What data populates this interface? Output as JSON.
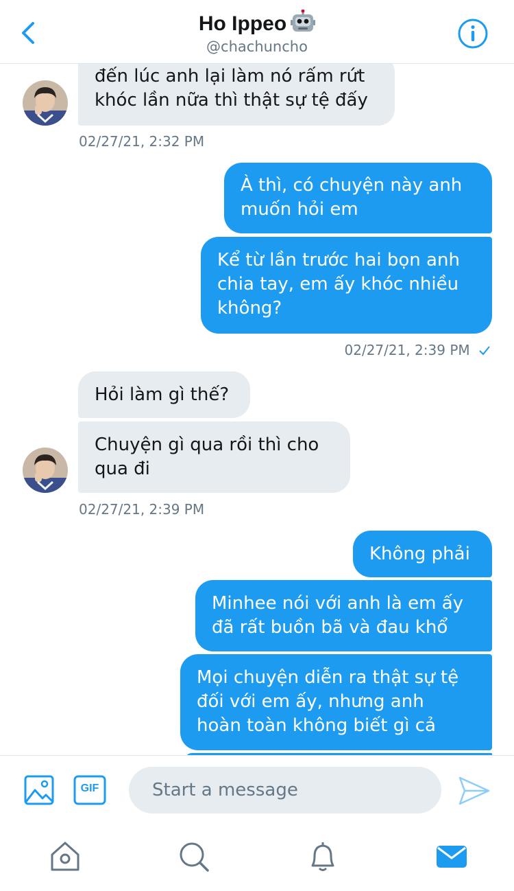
{
  "header": {
    "title": "Ho Ippeo",
    "title_emoji_icon": "robot-icon",
    "handle": "@chachuncho",
    "back_icon": "chevron-left-icon",
    "info_icon": "info-circle-icon"
  },
  "messages": [
    {
      "side": "in",
      "text": "đến lúc anh lại làm nó rấm rứt\nkhóc lần nữa thì thật sự tệ đấy"
    },
    {
      "side": "in",
      "timestamp": "02/27/21, 2:32 PM"
    },
    {
      "side": "out",
      "text": "À thì, có chuyện này anh\nmuốn hỏi em"
    },
    {
      "side": "out",
      "text": "Kể từ lần trước hai bọn anh\nchia tay, em ấy khóc nhiều\nkhông?"
    },
    {
      "side": "out",
      "timestamp": "02/27/21, 2:39 PM",
      "status_icon": "checkmark-icon"
    },
    {
      "side": "in",
      "text": "Hỏi làm gì thế?"
    },
    {
      "side": "in",
      "text": "Chuyện gì qua rồi thì cho\nqua đi"
    },
    {
      "side": "in",
      "timestamp": "02/27/21, 2:39 PM"
    },
    {
      "side": "out",
      "text": "Không phải"
    },
    {
      "side": "out",
      "text": "Minhee nói với anh là em ấy\nđã rất buồn bã và đau khổ"
    },
    {
      "side": "out",
      "text": "Mọi chuyện diễn ra thật sự tệ\nđối với em ấy, nhưng anh\nhoàn toàn không biết gì cả"
    }
  ],
  "composer": {
    "placeholder": "Start a message",
    "media_icon": "image-icon",
    "gif_label": "GIF",
    "send_icon": "send-icon"
  },
  "tabbar": {
    "items": [
      "home-icon",
      "search-icon",
      "bell-icon",
      "mail-icon"
    ],
    "active": "mail-icon"
  },
  "colors": {
    "accent": "#1d9bf0",
    "incoming_bubble": "#e6ecf0",
    "secondary_text": "#657786"
  }
}
